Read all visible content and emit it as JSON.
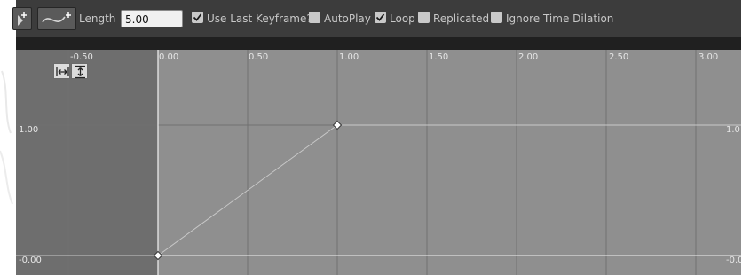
{
  "toolbar": {
    "length_label": "Length",
    "length_value": "5.00",
    "use_last_keyframe": {
      "label": "Use Last Keyframe?",
      "checked": true
    },
    "autoplay": {
      "label": "AutoPlay",
      "checked": false
    },
    "loop": {
      "label": "Loop",
      "checked": true
    },
    "replicated": {
      "label": "Replicated",
      "checked": false
    },
    "ignore_time_dilation": {
      "label": "Ignore Time Dilation",
      "checked": false
    }
  },
  "graph": {
    "time_ticks": [
      "-0.50",
      "0.00",
      "0.50",
      "1.00",
      "1.50",
      "2.00",
      "2.50",
      "3.00"
    ],
    "value_label_top_left": "1.00",
    "value_label_bottom_left": "-0.00",
    "value_label_top_right": "1.0",
    "value_label_bottom_right": "-0.0",
    "keys": [
      {
        "time": 0.0,
        "value": 0.0
      },
      {
        "time": 1.0,
        "value": 1.0
      }
    ],
    "colors": {
      "graph_bg": "#8f8f8f",
      "inactive_region": "#6e6e6e",
      "grid": "#707070",
      "curve": "#c8c8c8",
      "value_line": "#f2f2f2",
      "key_fill": "#ffffff"
    }
  },
  "icons": {
    "add_key": "add-key-icon",
    "curve": "curve-icon",
    "fit_horizontal": "fit-horizontal-icon",
    "fit_vertical": "fit-vertical-icon"
  }
}
